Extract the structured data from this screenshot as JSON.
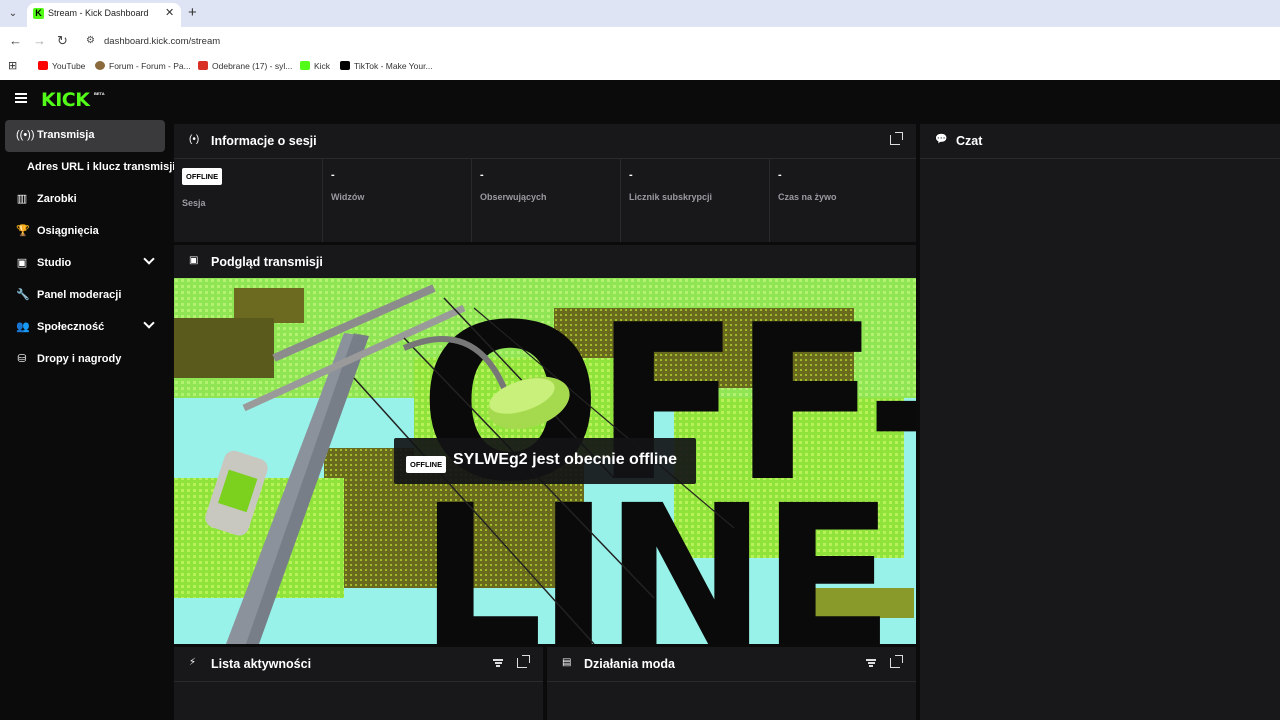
{
  "browser": {
    "tab_title": "Stream - Kick Dashboard",
    "url": "dashboard.kick.com/stream",
    "bookmarks": [
      {
        "label": "YouTube",
        "color": "#ff0000"
      },
      {
        "label": "Forum - Forum - Pa...",
        "color": "#8b6a3d"
      },
      {
        "label": "Odebrane (17) - syl...",
        "color": "#d93025"
      },
      {
        "label": "Kick",
        "color": "#53fc18"
      },
      {
        "label": "TikTok - Make Your...",
        "color": "#000000"
      }
    ]
  },
  "app": {
    "logo": "KICK",
    "beta": "BETA"
  },
  "sidebar": {
    "items": [
      {
        "label": "Transmisja",
        "icon": "broadcast-icon",
        "active": true
      },
      {
        "label": "Adres URL i klucz transmisji",
        "sub": true
      },
      {
        "label": "Zarobki",
        "icon": "chart-icon"
      },
      {
        "label": "Osiągnięcia",
        "icon": "trophy-icon"
      },
      {
        "label": "Studio",
        "icon": "studio-icon",
        "expandable": true
      },
      {
        "label": "Panel moderacji",
        "icon": "wrench-icon"
      },
      {
        "label": "Społeczność",
        "icon": "community-icon",
        "expandable": true
      },
      {
        "label": "Dropy i nagrody",
        "icon": "drops-icon"
      }
    ]
  },
  "session": {
    "title": "Informacje o sesji",
    "badge": "OFFLINE",
    "stats": [
      {
        "value": "",
        "label": "Sesja"
      },
      {
        "value": "-",
        "label": "Widzów"
      },
      {
        "value": "-",
        "label": "Obserwujących"
      },
      {
        "value": "-",
        "label": "Licznik subskrypcji"
      },
      {
        "value": "-",
        "label": "Czas na żywo"
      }
    ]
  },
  "preview": {
    "title": "Podgląd transmisji",
    "badge": "OFFLINE",
    "message": "SYLWEg2 jest obecnie offline",
    "art_text_1": "OFF-",
    "art_text_2": "LINE"
  },
  "chat": {
    "title": "Czat"
  },
  "activity": {
    "title": "Lista aktywności"
  },
  "mod": {
    "title": "Działania moda"
  },
  "colors": {
    "accent": "#53fc18",
    "panel": "#18181b",
    "background": "#0b0b0c"
  }
}
